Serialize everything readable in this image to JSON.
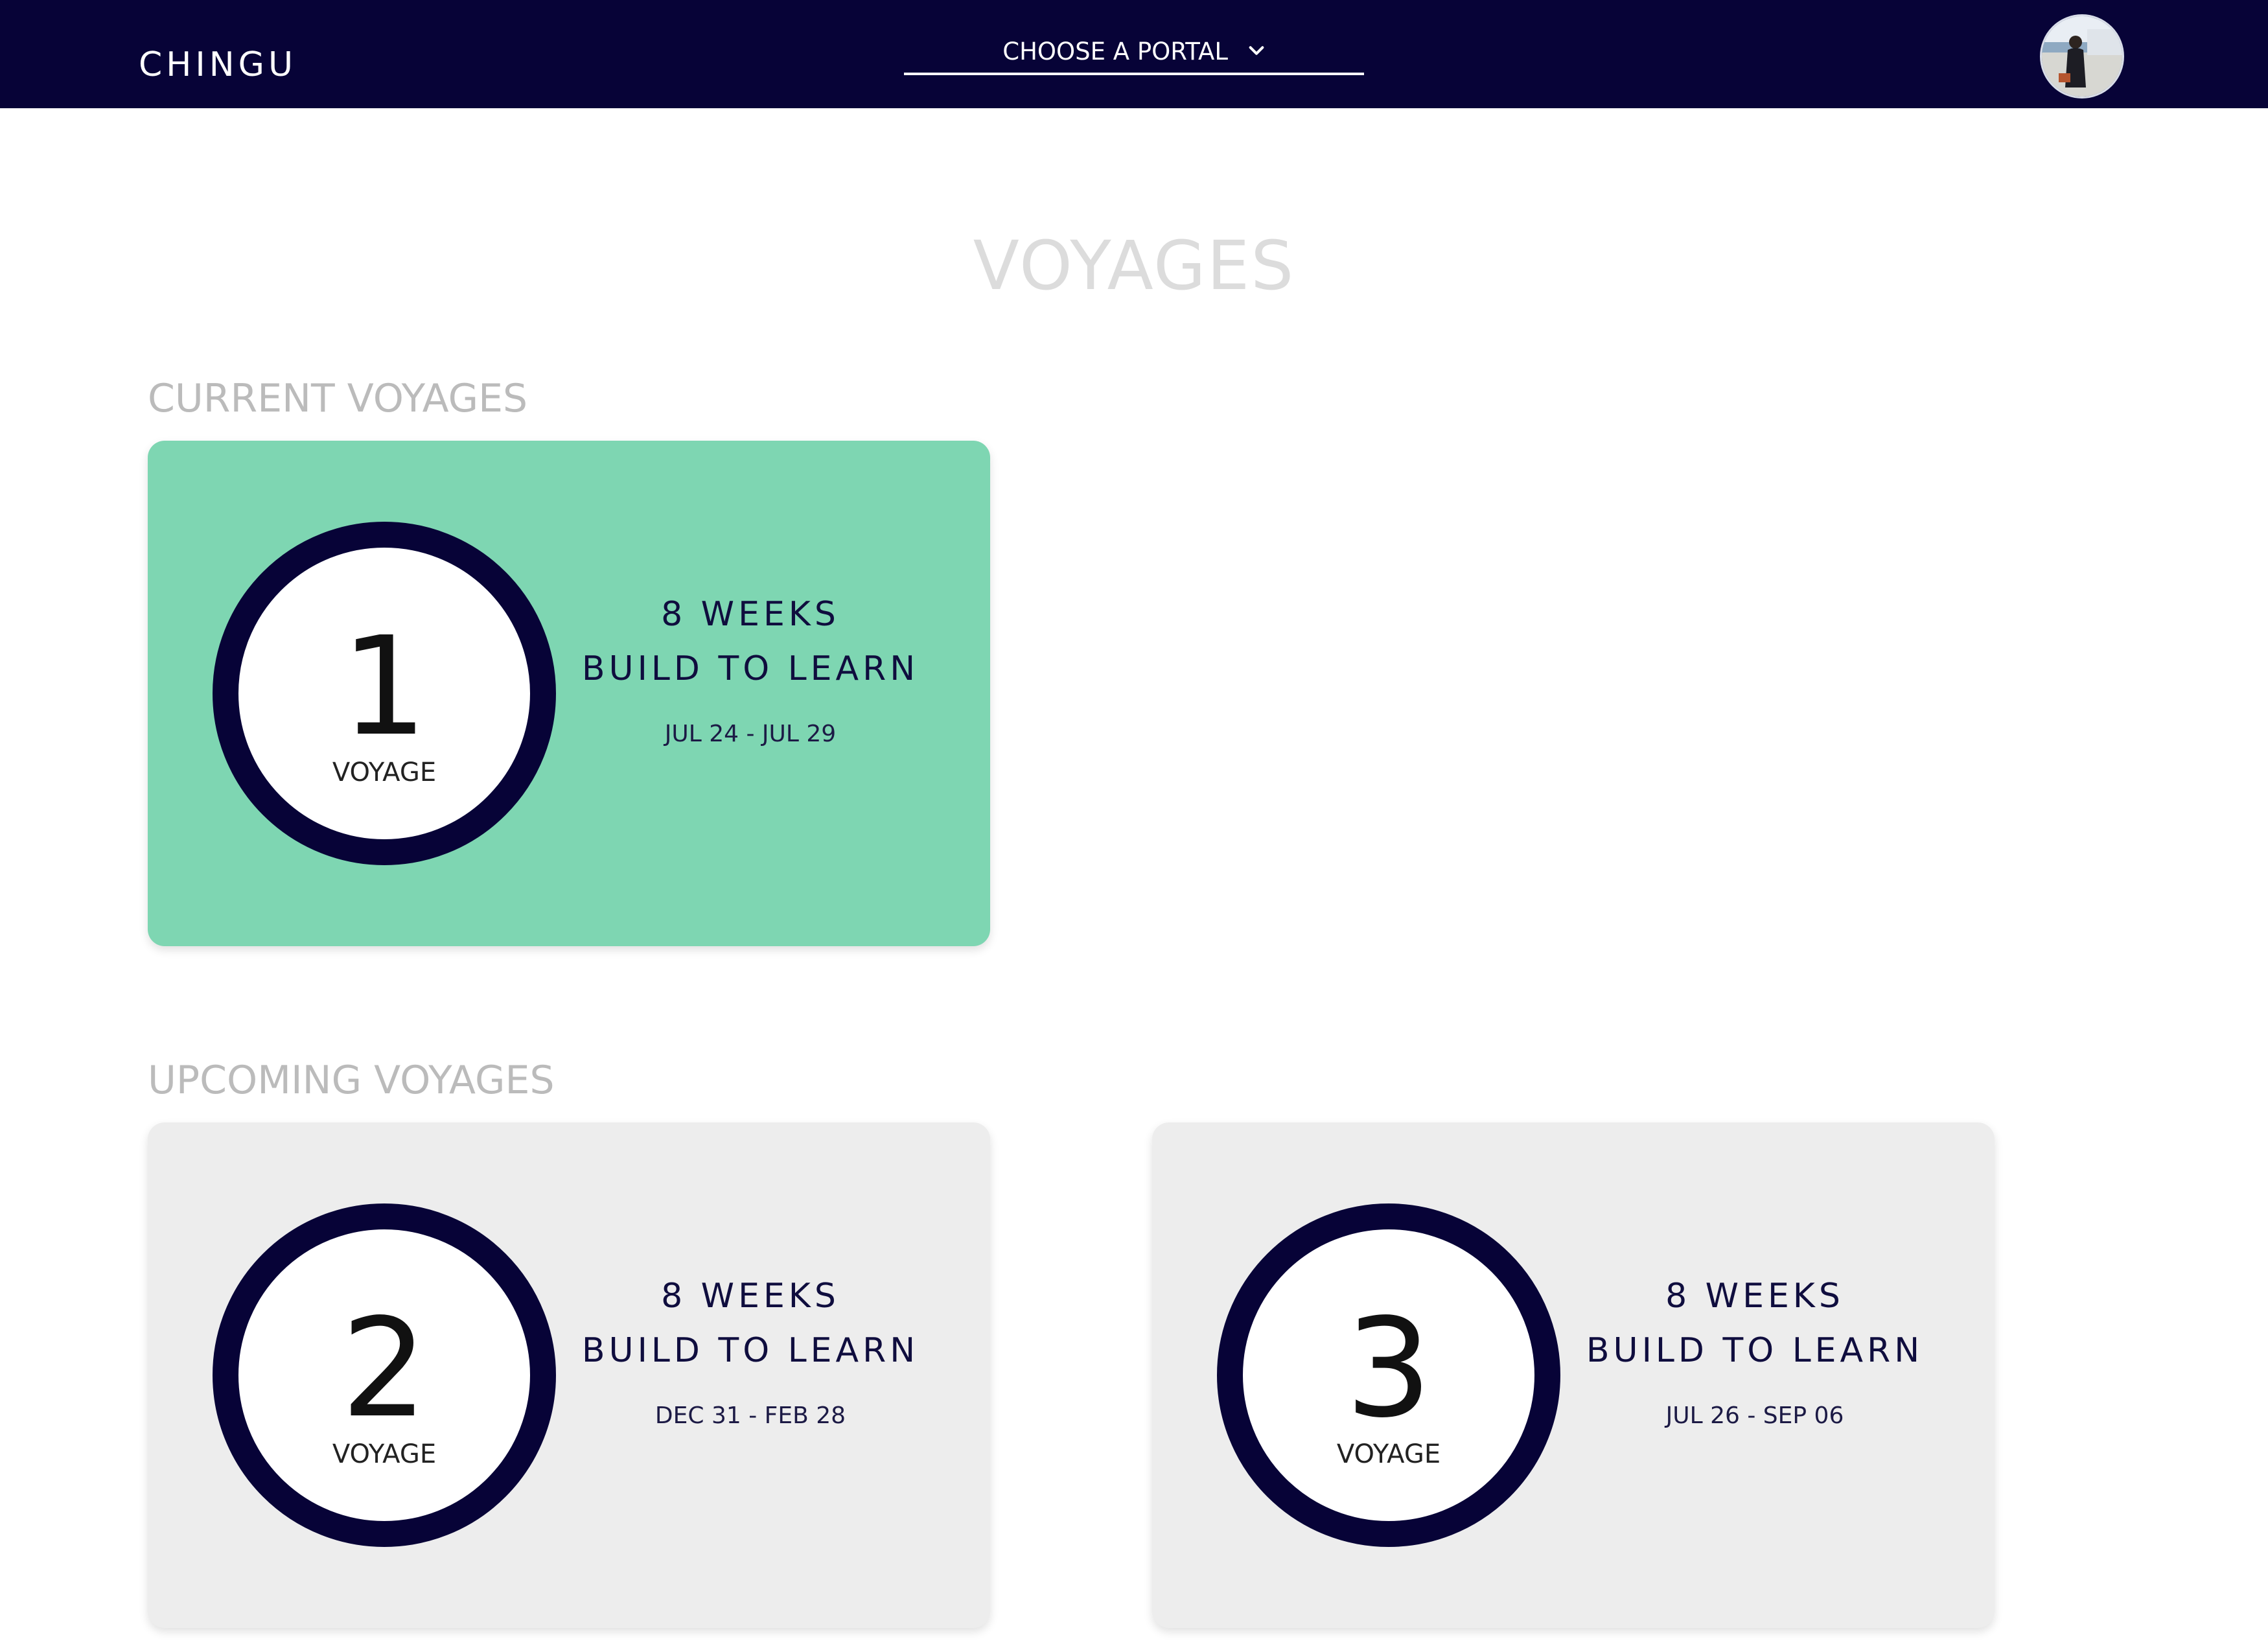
{
  "navbar": {
    "brand": "CHINGU",
    "portal_label": "CHOOSE A PORTAL",
    "portal_icon": "chevron-down-icon",
    "avatar_icon": "user-avatar",
    "background_color": "#070337"
  },
  "page": {
    "title": "VOYAGES"
  },
  "sections": {
    "current": {
      "title": "CURRENT VOYAGES",
      "cards": [
        {
          "number": "1",
          "label": "VOYAGE",
          "duration": "8 WEEKS",
          "tagline": "BUILD TO LEARN",
          "dates": "JUL 24 - JUL 29",
          "color": "#7ed6b2"
        }
      ]
    },
    "upcoming": {
      "title": "UPCOMING VOYAGES",
      "cards": [
        {
          "number": "2",
          "label": "VOYAGE",
          "duration": "8 WEEKS",
          "tagline": "BUILD TO LEARN",
          "dates": "DEC 31 - FEB 28",
          "color": "#ededed"
        },
        {
          "number": "3",
          "label": "VOYAGE",
          "duration": "8 WEEKS",
          "tagline": "BUILD TO LEARN",
          "dates": "JUL 26 - SEP 06",
          "color": "#ededed"
        }
      ]
    }
  }
}
